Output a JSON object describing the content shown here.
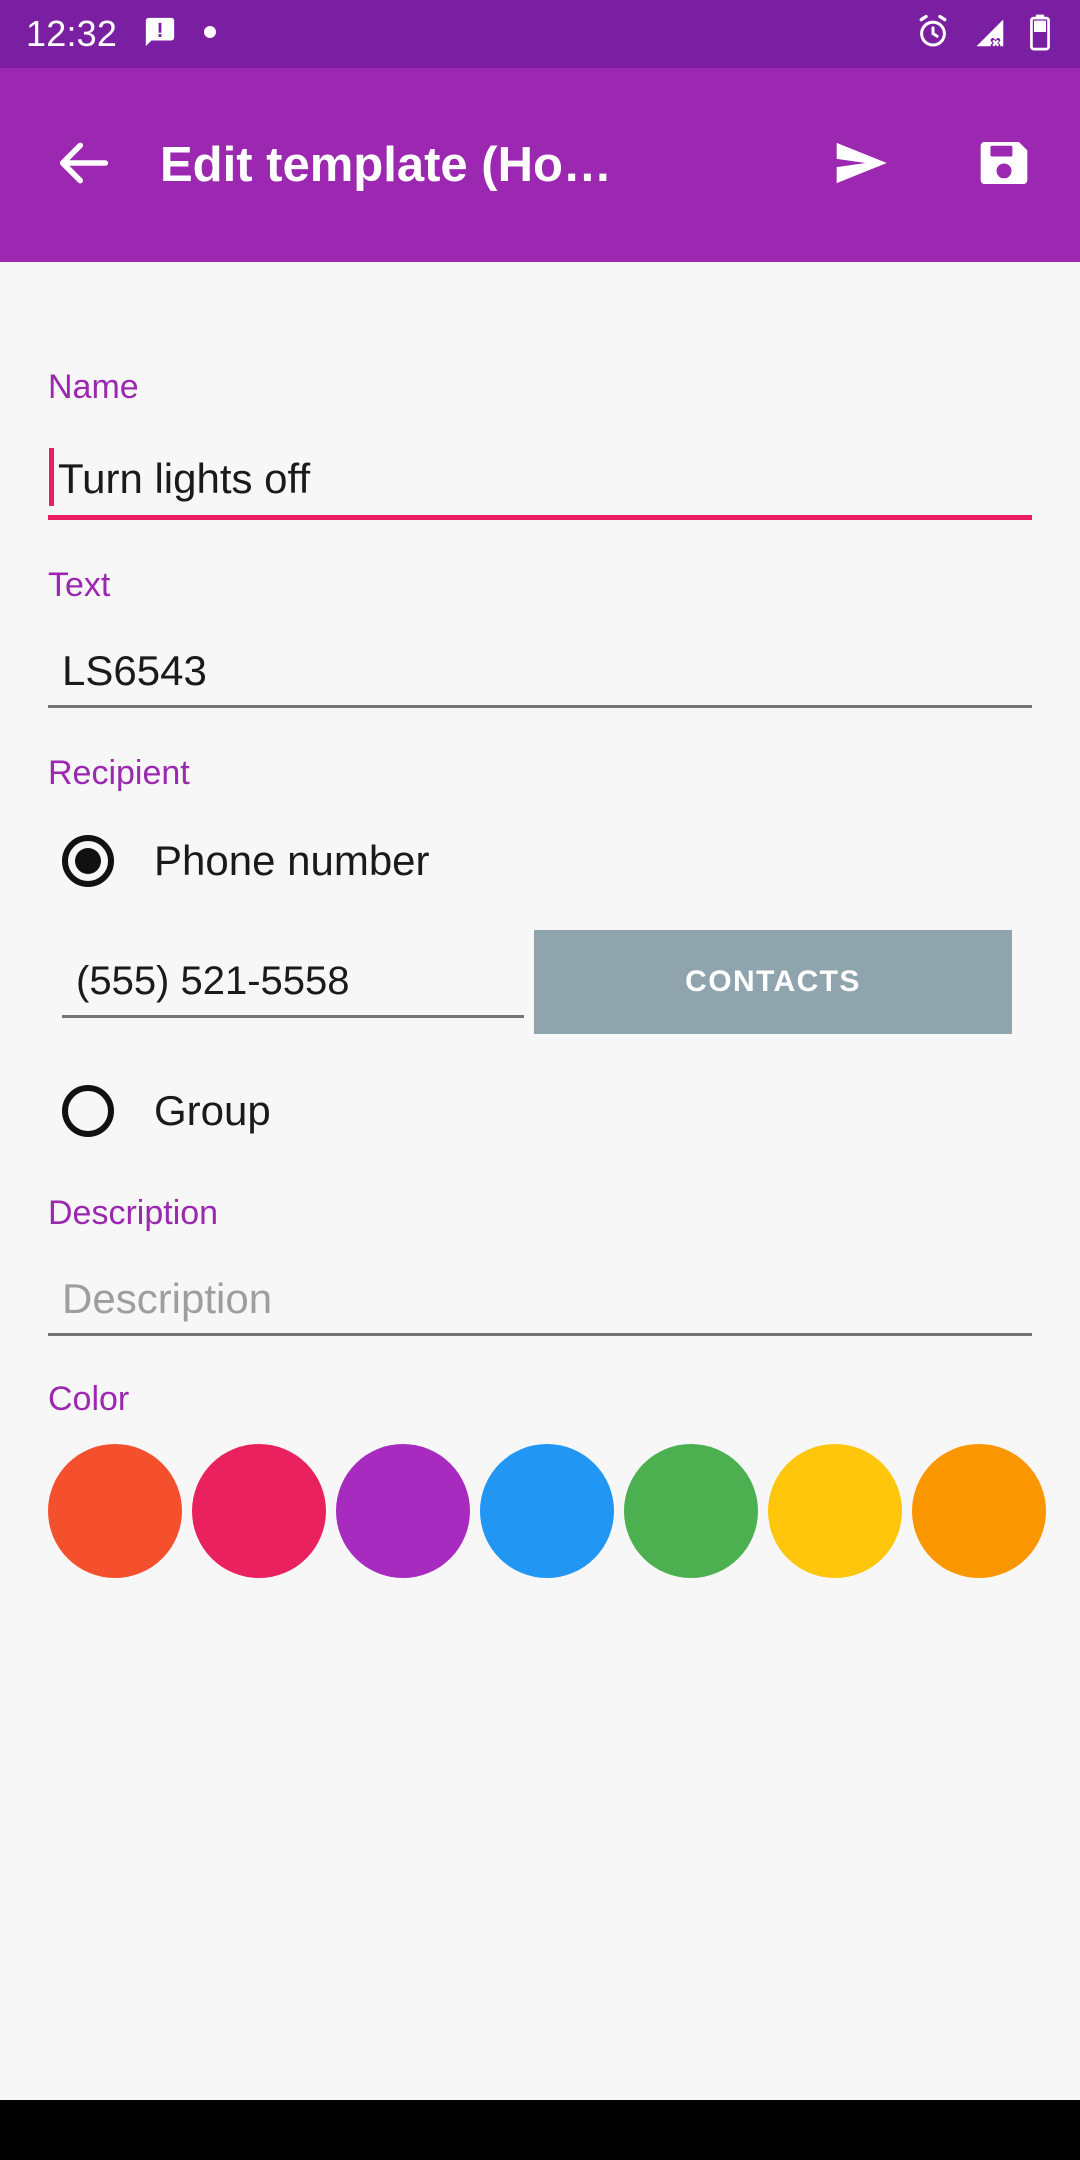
{
  "status_bar": {
    "time": "12:32",
    "left_icons": [
      "message-alert-icon",
      "dot-icon"
    ],
    "right_icons": [
      "alarm-icon",
      "signal-off-icon",
      "battery-icon"
    ],
    "background_color": "#7B1FA2"
  },
  "app_bar": {
    "title": "Edit template (Ho…",
    "back_icon": "arrow-back-icon",
    "send_icon": "send-icon",
    "save_icon": "save-icon",
    "background_color": "#9C27B0"
  },
  "form": {
    "name": {
      "label": "Name",
      "value": "Turn lights off",
      "focused": true,
      "accent_color": "#E91E63"
    },
    "text": {
      "label": "Text",
      "value": "LS6543"
    },
    "recipient": {
      "label": "Recipient",
      "options": [
        {
          "label": "Phone number",
          "selected": true
        },
        {
          "label": "Group",
          "selected": false
        }
      ],
      "phone_value": "(555) 521-5558",
      "contacts_button": "CONTACTS",
      "contacts_button_color": "#90A4AE"
    },
    "description": {
      "label": "Description",
      "value": "",
      "placeholder": "Description"
    },
    "color": {
      "label": "Color",
      "swatches": [
        {
          "name": "red",
          "hex": "#F4502E"
        },
        {
          "name": "pink",
          "hex": "#E9215F"
        },
        {
          "name": "purple",
          "hex": "#A62BBE"
        },
        {
          "name": "blue",
          "hex": "#2196F3"
        },
        {
          "name": "green",
          "hex": "#4CAF50"
        },
        {
          "name": "yellow",
          "hex": "#FFC60B"
        },
        {
          "name": "orange",
          "hex": "#FA9600"
        }
      ]
    },
    "label_color": "#9C27B0"
  }
}
